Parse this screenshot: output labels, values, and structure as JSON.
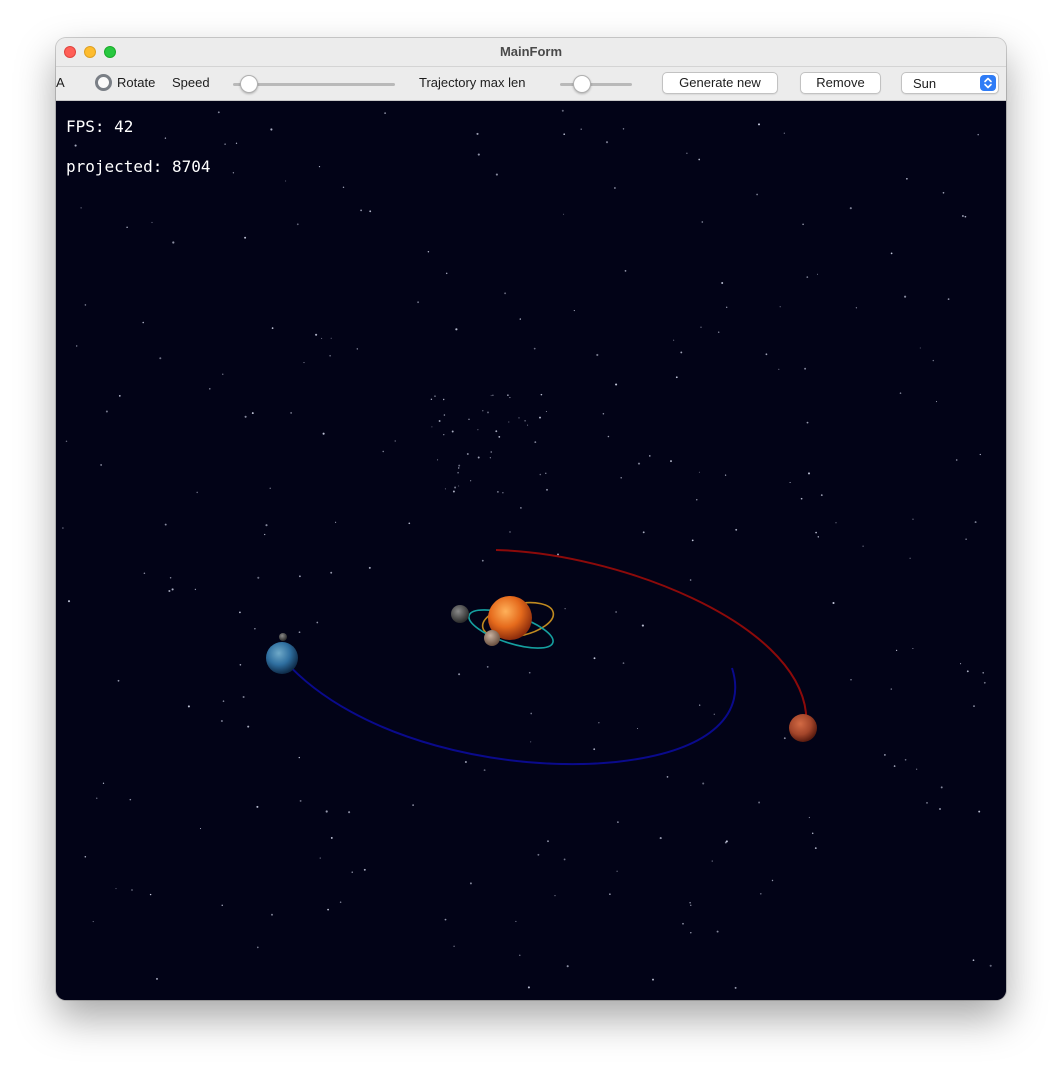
{
  "window": {
    "title": "MainForm"
  },
  "toolbar": {
    "cut_label": "A",
    "rotate_label": "Rotate",
    "rotate_checked": false,
    "speed_label": "Speed",
    "speed_value": 0.1,
    "trajectory_label": "Trajectory max len",
    "trajectory_value": 0.3,
    "generate_label": "Generate new",
    "remove_label": "Remove",
    "body_select_value": "Sun"
  },
  "hud": {
    "fps": "FPS: 42",
    "projected": "projected: 8704"
  },
  "colors": {
    "space": "#020317",
    "earth_trajectory": "#0a0a8c",
    "mars_trajectory": "#8c0a0a",
    "inner_orbit_1": "#c08a20",
    "inner_orbit_2": "#15a0a0",
    "sun": "#e56a1c",
    "mars": "#a3452a",
    "earth": "#2f6fa0",
    "accent_blue": "#2f7cf6"
  },
  "icons": {
    "close": "close-traffic-light",
    "minimize": "minimize-traffic-light",
    "zoom": "zoom-traffic-light",
    "select_arrow": "updown-chevron-icon"
  }
}
